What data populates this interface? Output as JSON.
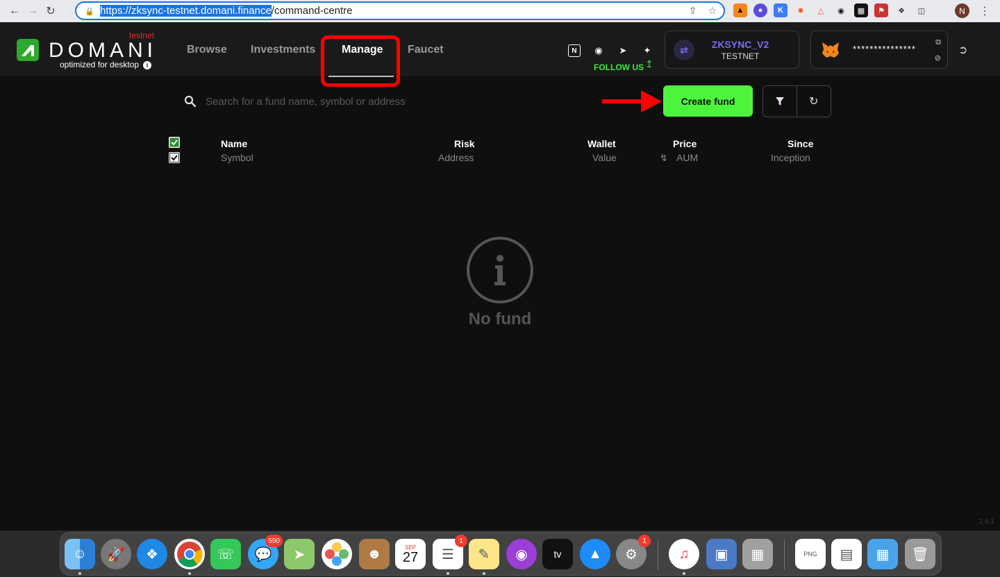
{
  "browser": {
    "url_selected": "https://zksync-testnet.domani.finance",
    "url_rest": "/command-centre",
    "profile_initial": "N"
  },
  "app": {
    "logo_text": "DOMANI",
    "badge": "testnet",
    "tagline": "optimized for desktop"
  },
  "nav": {
    "browse": "Browse",
    "investments": "Investments",
    "manage": "Manage",
    "faucet": "Faucet"
  },
  "social": {
    "follow_label": "FOLLOW US"
  },
  "network": {
    "name": "ZKSYNC_V2",
    "sub": "TESTNET"
  },
  "wallet": {
    "address": "***************"
  },
  "search": {
    "placeholder": "Search for a fund name, symbol or address"
  },
  "actions": {
    "create_fund": "Create fund"
  },
  "table": {
    "headers": {
      "name": "Name",
      "symbol": "Symbol",
      "risk": "Risk",
      "address": "Address",
      "wallet": "Wallet",
      "value": "Value",
      "price": "Price",
      "aum": "AUM",
      "since": "Since",
      "inception": "Inception"
    }
  },
  "empty": {
    "message": "No fund"
  },
  "version": "2.8.1",
  "dock": {
    "messages_badge": "550",
    "calendar_month": "SEP",
    "calendar_day": "27",
    "reminders_badge": "1",
    "settings_badge": "1"
  },
  "colors": {
    "accent_green": "#4cf53c",
    "network_purple": "#7b6cf6",
    "highlight_red": "#ff0000"
  }
}
